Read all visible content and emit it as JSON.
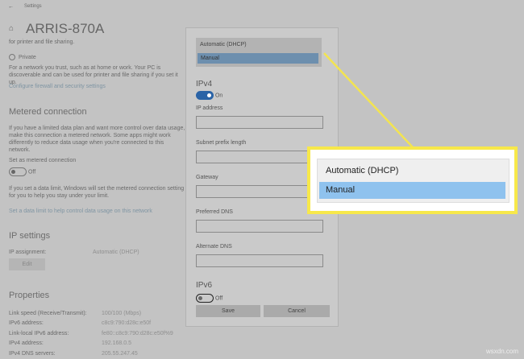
{
  "window": {
    "title": "Settings",
    "back_icon": "arrow-left"
  },
  "header": {
    "title": "ARRIS-870A",
    "icon": "home"
  },
  "network": {
    "sharing_text": "for printer and file sharing.",
    "private_label": "Private",
    "private_desc": "For a network you trust, such as at home or work. Your PC is discoverable and can be used for printer and file sharing if you set it up.",
    "firewall_link": "Configure firewall and security settings"
  },
  "metered": {
    "heading": "Metered connection",
    "desc": "If you have a limited data plan and want more control over data usage, make this connection a metered network. Some apps might work differently to reduce data usage when you're connected to this network.",
    "toggle_label": "Set as metered connection",
    "toggle_state": "Off",
    "limit_desc": "If you set a data limit, Windows will set the metered connection setting for you to help you stay under your limit.",
    "limit_link": "Set a data limit to help control data usage on this network"
  },
  "ip_settings": {
    "heading": "IP settings",
    "assignment_label": "IP assignment:",
    "assignment_value": "Automatic (DHCP)",
    "edit_label": "Edit"
  },
  "properties": {
    "heading": "Properties",
    "rows": [
      {
        "label": "Link speed (Receive/Transmit):",
        "value": "100/100 (Mbps)"
      },
      {
        "label": "IPv6 address:",
        "value": "c8c9:790:d28c:e50f"
      },
      {
        "label": "Link-local IPv6 address:",
        "value": "fe80::c8c9:790:d28c:e50f%9"
      },
      {
        "label": "IPv4 address:",
        "value": "192.168.0.5"
      },
      {
        "label": "IPv4 DNS servers:",
        "value": "205.55.247.45"
      }
    ]
  },
  "dialog": {
    "options": [
      "Automatic (DHCP)",
      "Manual"
    ],
    "selected": "Manual",
    "ipv4_heading": "IPv4",
    "ipv4_state": "On",
    "fields": [
      "IP address",
      "Subnet prefix length",
      "Gateway",
      "Preferred DNS",
      "Alternate DNS"
    ],
    "ipv6_heading": "IPv6",
    "ipv6_state": "Off",
    "save_label": "Save",
    "cancel_label": "Cancel"
  },
  "callout": {
    "options": [
      "Automatic (DHCP)",
      "Manual"
    ],
    "border_color": "#f7e84a",
    "highlight_color": "#8fc2ee"
  },
  "watermark": "wsxdn.com"
}
